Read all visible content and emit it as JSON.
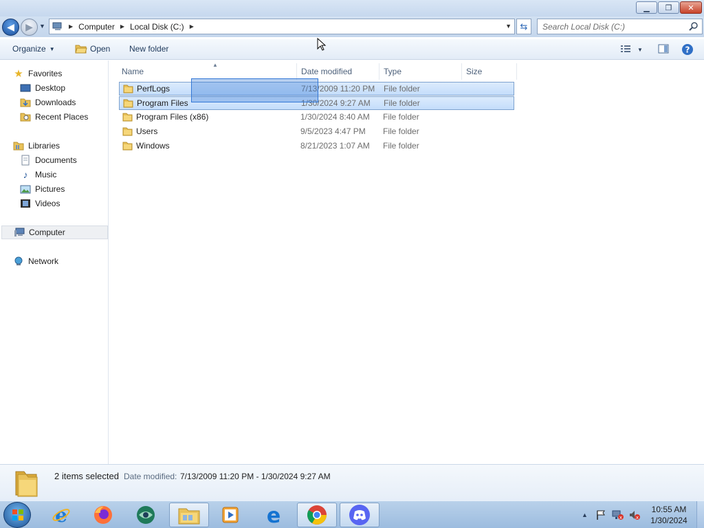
{
  "window": {
    "minimize_icon": "minimize-icon",
    "maximize_icon": "restore-icon",
    "close_icon": "close-icon"
  },
  "address": {
    "crumbs": [
      "Computer",
      "Local Disk (C:)"
    ],
    "search_placeholder": "Search Local Disk (C:)"
  },
  "toolbar": {
    "organize_label": "Organize",
    "open_label": "Open",
    "newfolder_label": "New folder"
  },
  "nav": {
    "favorites": "Favorites",
    "desktop": "Desktop",
    "downloads": "Downloads",
    "recent": "Recent Places",
    "libraries": "Libraries",
    "documents": "Documents",
    "music": "Music",
    "pictures": "Pictures",
    "videos": "Videos",
    "computer": "Computer",
    "network": "Network"
  },
  "columns": {
    "name": "Name",
    "date": "Date modified",
    "type": "Type",
    "size": "Size"
  },
  "files": [
    {
      "name": "PerfLogs",
      "date": "7/13/2009 11:20 PM",
      "type": "File folder",
      "selected": true
    },
    {
      "name": "Program Files",
      "date": "1/30/2024 9:27 AM",
      "type": "File folder",
      "selected": true
    },
    {
      "name": "Program Files (x86)",
      "date": "1/30/2024 8:40 AM",
      "type": "File folder",
      "selected": false
    },
    {
      "name": "Users",
      "date": "9/5/2023 4:47 PM",
      "type": "File folder",
      "selected": false
    },
    {
      "name": "Windows",
      "date": "8/21/2023 1:07 AM",
      "type": "File folder",
      "selected": false
    }
  ],
  "details": {
    "count": "2 items selected",
    "date_label": "Date modified:",
    "date_value": "7/13/2009 11:20 PM - 1/30/2024 9:27 AM"
  },
  "taskbar": {
    "apps": [
      "internet-explorer-icon",
      "firefox-icon",
      "app-icon",
      "file-explorer-icon",
      "media-player-icon",
      "edge-icon",
      "chrome-icon",
      "discord-icon"
    ],
    "time": "10:55 AM",
    "date": "1/30/2024"
  },
  "colors": {
    "selection": "#cce0fb",
    "folder": "#e9c25a"
  }
}
